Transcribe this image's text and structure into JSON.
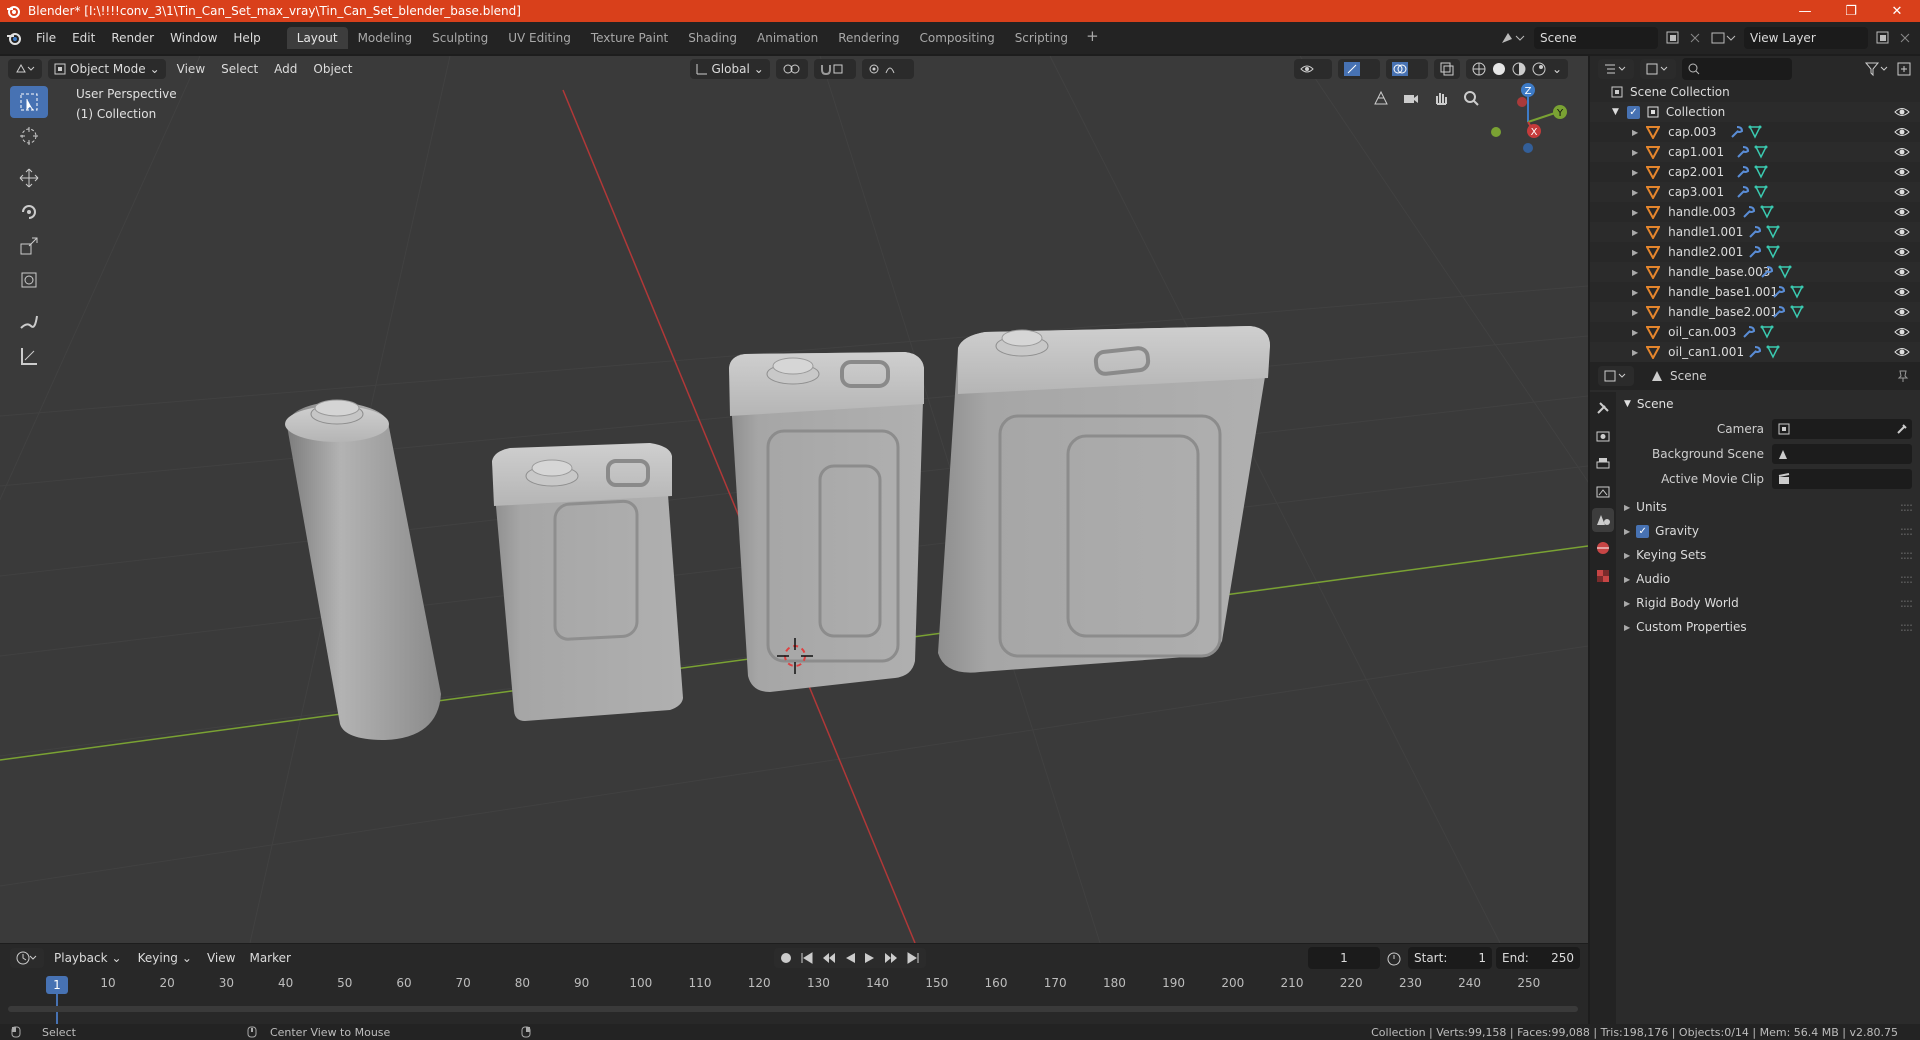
{
  "window": {
    "title": "Blender* [I:\\!!!!conv_3\\1\\Tin_Can_Set_max_vray\\Tin_Can_Set_blender_base.blend]",
    "minimize": "—",
    "maximize": "❐",
    "close": "✕"
  },
  "menubar": {
    "items": [
      "File",
      "Edit",
      "Render",
      "Window",
      "Help"
    ]
  },
  "workspaces": {
    "tabs": [
      "Layout",
      "Modeling",
      "Sculpting",
      "UV Editing",
      "Texture Paint",
      "Shading",
      "Animation",
      "Rendering",
      "Compositing",
      "Scripting"
    ],
    "active": "Layout",
    "add": "+"
  },
  "scene_selector": {
    "value": "Scene"
  },
  "view_layer_selector": {
    "value": "View Layer"
  },
  "viewport": {
    "mode": "Object Mode",
    "menus": [
      "View",
      "Select",
      "Add",
      "Object"
    ],
    "transform_orientation": "Global",
    "info_line1": "User Perspective",
    "info_line2": "(1) Collection",
    "gizmo": {
      "x": "X",
      "y": "Y",
      "z": "Z"
    },
    "colors": {
      "bg": "#3a3a3a",
      "grid_x": "#b03838",
      "grid_y": "#7aa233",
      "mesh": "#a9a9a9"
    }
  },
  "outliner": {
    "root": "Scene Collection",
    "collection": "Collection",
    "items": [
      "cap.003",
      "cap1.001",
      "cap2.001",
      "cap3.001",
      "handle.003",
      "handle1.001",
      "handle2.001",
      "handle_base.003",
      "handle_base1.001",
      "handle_base2.001",
      "oil_can.003",
      "oil_can1.001"
    ]
  },
  "properties": {
    "header": "Scene",
    "panel": "Scene",
    "fields": [
      {
        "label": "Camera",
        "value": ""
      },
      {
        "label": "Background Scene",
        "value": ""
      },
      {
        "label": "Active Movie Clip",
        "value": ""
      }
    ],
    "subpanels": [
      {
        "label": "Units",
        "checkbox": false
      },
      {
        "label": "Gravity",
        "checkbox": true
      },
      {
        "label": "Keying Sets",
        "checkbox": false
      },
      {
        "label": "Audio",
        "checkbox": false
      },
      {
        "label": "Rigid Body World",
        "checkbox": false
      },
      {
        "label": "Custom Properties",
        "checkbox": false
      }
    ]
  },
  "timeline": {
    "menus": [
      "Playback",
      "Keying",
      "View",
      "Marker"
    ],
    "current_frame": "1",
    "start_label": "Start:",
    "start": "1",
    "end_label": "End:",
    "end": "250",
    "ticks": [
      "10",
      "20",
      "30",
      "40",
      "50",
      "60",
      "70",
      "80",
      "90",
      "100",
      "110",
      "120",
      "130",
      "140",
      "150",
      "160",
      "170",
      "180",
      "190",
      "200",
      "210",
      "220",
      "230",
      "240",
      "250"
    ],
    "current_tick": "1"
  },
  "statusbar": {
    "left": "Select",
    "middle": "Center View to Mouse",
    "stats": "Collection | Verts:99,158 | Faces:99,088 | Tris:198,176 | Objects:0/14 | Mem: 56.4 MB | v2.80.75"
  }
}
